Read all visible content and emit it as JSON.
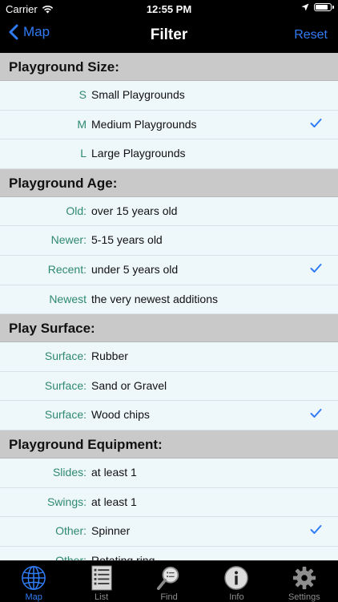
{
  "status": {
    "carrier": "Carrier",
    "time": "12:55 PM"
  },
  "nav": {
    "back_label": "Map",
    "title": "Filter",
    "reset_label": "Reset"
  },
  "colors": {
    "accent": "#2f7cf6",
    "key_text": "#2e8a6e",
    "header_bg": "#c9c9c9",
    "row_bg": "#eef7fa"
  },
  "sections": [
    {
      "title": "Playground Size:",
      "rows": [
        {
          "key": "S",
          "value": "Small Playgrounds",
          "checked": false
        },
        {
          "key": "M",
          "value": "Medium Playgrounds",
          "checked": true
        },
        {
          "key": "L",
          "value": "Large Playgrounds",
          "checked": false
        }
      ]
    },
    {
      "title": "Playground Age:",
      "rows": [
        {
          "key": "Old:",
          "value": "over 15 years old",
          "checked": false
        },
        {
          "key": "Newer:",
          "value": "5-15 years old",
          "checked": false
        },
        {
          "key": "Recent:",
          "value": "under 5 years old",
          "checked": true
        },
        {
          "key": "Newest",
          "value": "the very newest additions",
          "checked": false
        }
      ]
    },
    {
      "title": "Play Surface:",
      "rows": [
        {
          "key": "Surface:",
          "value": "Rubber",
          "checked": false
        },
        {
          "key": "Surface:",
          "value": "Sand or Gravel",
          "checked": false
        },
        {
          "key": "Surface:",
          "value": "Wood chips",
          "checked": true
        }
      ]
    },
    {
      "title": "Playground Equipment:",
      "rows": [
        {
          "key": "Slides:",
          "value": "at least 1",
          "checked": false
        },
        {
          "key": "Swings:",
          "value": "at least 1",
          "checked": false
        },
        {
          "key": "Other:",
          "value": "Spinner",
          "checked": true
        },
        {
          "key": "Other:",
          "value": "Rotating ring",
          "checked": false
        }
      ]
    }
  ],
  "tabs": [
    {
      "label": "Map",
      "icon": "globe-icon",
      "active": true
    },
    {
      "label": "List",
      "icon": "list-icon",
      "active": false
    },
    {
      "label": "Find",
      "icon": "magnifier-icon",
      "active": false
    },
    {
      "label": "Info",
      "icon": "info-icon",
      "active": false
    },
    {
      "label": "Settings",
      "icon": "gear-icon",
      "active": false
    }
  ]
}
